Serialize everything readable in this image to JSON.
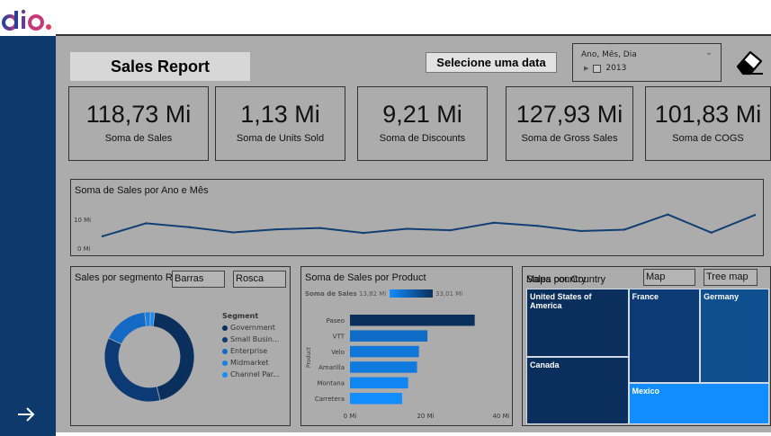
{
  "report": {
    "title": "Sales Report",
    "date_prompt": "Selecione uma data"
  },
  "slicer": {
    "header": "Ano, Mês, Dia",
    "items": [
      {
        "label": "2013",
        "checked": false
      }
    ]
  },
  "icons": {
    "logo": "dio-logo",
    "eraser": "eraser-icon",
    "next": "arrow-right-icon",
    "slicer_expand": "chevron-down-icon"
  },
  "kpis": [
    {
      "value": "118,73 Mi",
      "label": "Soma de  Sales"
    },
    {
      "value": "1,13 Mi",
      "label": "Soma de Units Sold"
    },
    {
      "value": "9,21 Mi",
      "label": "Soma de Discounts"
    },
    {
      "value": "127,93 Mi",
      "label": "Soma de Gross Sales"
    },
    {
      "value": "101,83 Mi",
      "label": "Soma de COGS"
    }
  ],
  "line_panel": {
    "title": "Soma de Sales por Ano e Mês",
    "tick_labels": [
      "10 Mi",
      "0 Mi"
    ]
  },
  "segment_panel": {
    "title": "Sales por segmento Rosca",
    "buttons": [
      "Barras",
      "Rosca"
    ],
    "legend_title": "Segment"
  },
  "product_panel": {
    "title": "Soma de Sales por Product",
    "scale_label": "Soma de  Sales",
    "scale_min": "13,82 Mi",
    "scale_max": "33,01 Mi",
    "y_axis_label": "Product",
    "x_ticks": [
      "0 Mi",
      "20 Mi",
      "40 Mi"
    ]
  },
  "country_panel": {
    "title": "Sales por Country",
    "overlay_title": "Mapa country",
    "buttons": [
      "Map",
      "Tree map"
    ]
  },
  "colors": {
    "sidebar": "#0d3a6b",
    "dark_navy": "#0b2f5c",
    "mid_blue": "#0d4f8f",
    "light_blue": "#118dff",
    "canvas": "#acacac"
  },
  "chart_data": [
    {
      "type": "line",
      "title": "Soma de Sales por Ano e Mês",
      "ylim": [
        0,
        15
      ],
      "yticks": [
        0,
        10
      ],
      "series": [
        {
          "values": [
            4.3,
            9.0,
            7.6,
            5.7,
            6.8,
            7.3,
            5.5,
            7.0,
            6.5,
            9.2,
            8.1,
            6.2,
            6.7,
            12.2,
            5.6,
            12.0
          ]
        }
      ],
      "grid": false
    },
    {
      "type": "pie",
      "donut": true,
      "legend_title": "Segment",
      "legend_position": "right",
      "labels": [
        "Government",
        "Small Busin...",
        "Enterprise",
        "Midmarket",
        "Channel Par..."
      ],
      "values": [
        52.5,
        42.4,
        19.6,
        2.4,
        1.8
      ],
      "colors": [
        "#0b2f5c",
        "#0c3a75",
        "#1369c4",
        "#1a7fe0",
        "#118dff"
      ]
    },
    {
      "type": "bar",
      "orientation": "horizontal",
      "title": "Soma de Sales por Product",
      "ylabel": "Product",
      "categories": [
        "Paseo",
        "VTT",
        "Velo",
        "Amarilla",
        "Montana",
        "Carretera"
      ],
      "values": [
        33.01,
        20.51,
        18.25,
        17.75,
        15.39,
        13.82
      ],
      "xlim": [
        0,
        40
      ],
      "xticks": [
        0,
        20,
        40
      ],
      "color_scale": {
        "min": 13.82,
        "max": 33.01,
        "min_color": "#118dff",
        "max_color": "#0b2f5c"
      }
    },
    {
      "type": "treemap",
      "title": "Sales por Country",
      "categories": [
        "United States of America",
        "Canada",
        "France",
        "Germany",
        "Mexico"
      ],
      "values": [
        25.03,
        24.89,
        24.35,
        23.51,
        20.95
      ],
      "colors": [
        "#0b2f5c",
        "#0b2f5c",
        "#0c3a75",
        "#0d4f8f",
        "#118dff"
      ]
    }
  ]
}
